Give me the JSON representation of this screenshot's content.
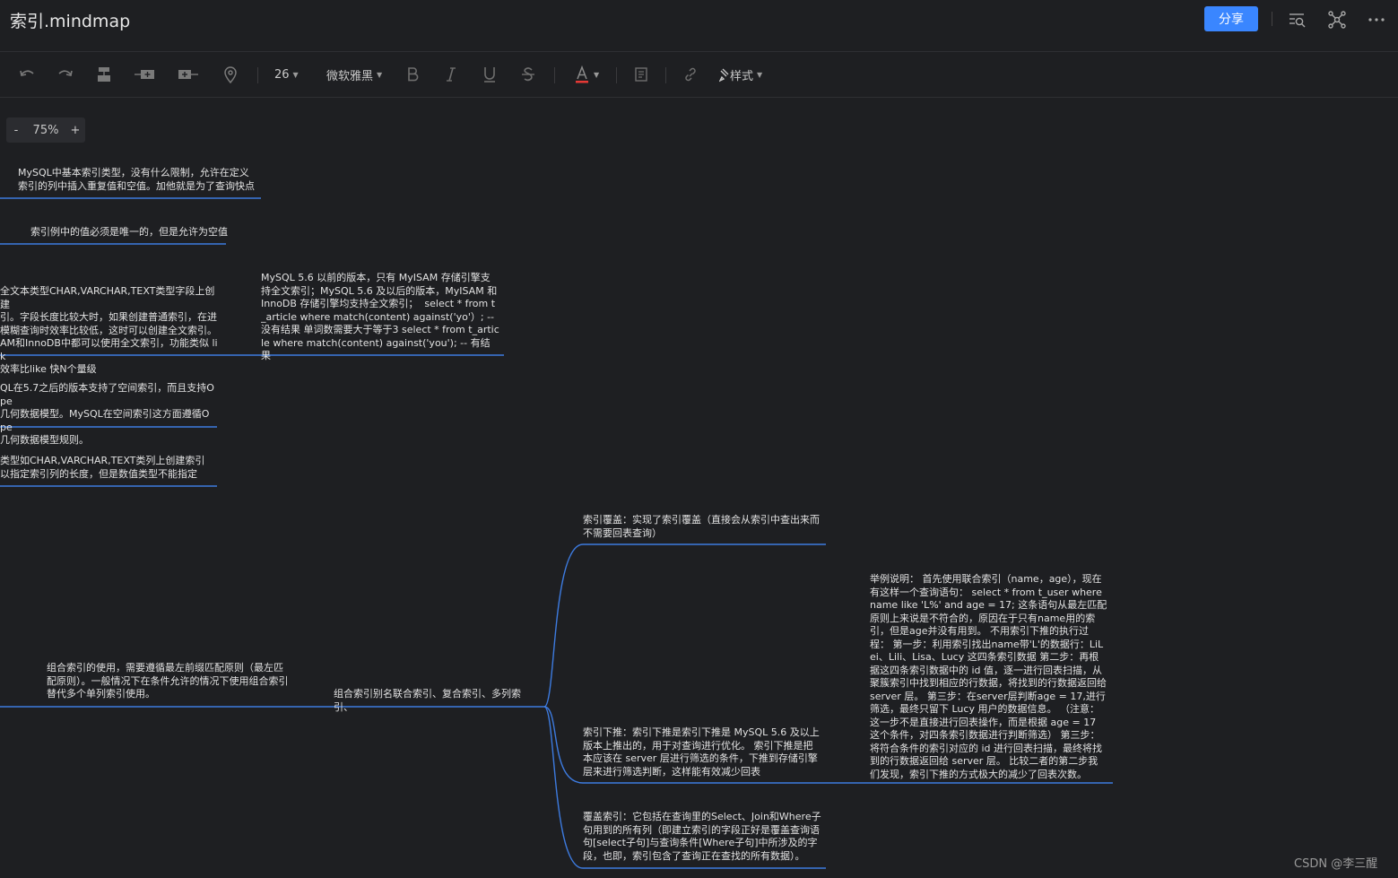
{
  "header": {
    "title": "索引.mindmap",
    "share_label": "分享",
    "icons": [
      "search-outline-icon",
      "mindmap-structure-icon",
      "more-icon"
    ]
  },
  "toolbar": {
    "font_size": "26",
    "font_family": "微软雅黑",
    "style_label": "样式",
    "icons": [
      "undo-icon",
      "redo-icon",
      "insert-child-icon",
      "insert-sibling-icon",
      "insert-parent-icon",
      "location-icon",
      "bold-icon",
      "italic-icon",
      "underline-icon",
      "strikethrough-icon",
      "font-color-icon",
      "note-icon",
      "link-icon",
      "style-brush-icon"
    ],
    "font_color": "#e53935"
  },
  "zoom": {
    "minus": "-",
    "value": "75%",
    "plus": "+"
  },
  "nodes": {
    "normal_index": "MySQL中基本索引类型，没有什么限制，允许在定义索引的列中插入重复值和空值。加他就是为了查询快点",
    "unique_index": "索引例中的值必须是唯一的，但是允许为空值",
    "fulltext_left": "全文本类型CHAR,VARCHAR,TEXT类型字段上创建\n引。字段长度比较大时，如果创建普通索引，在进\n模糊查询时效率比较低，这时可以创建全文索引。\nAM和InnoDB中都可以使用全文索引，功能类似 lik\n效率比like 快N个量级",
    "fulltext_right": "MySQL 5.6 以前的版本，只有 MyISAM 存储引擎支持全文索引；MySQL 5.6 及以后的版本，MyISAM 和 InnoDB 存储引擎均支持全文索引；  select * from t_article where match(content) against('yo'）; -- 没有结果 单词数需要大于等于3 select * from t_article where match(content) against('you'); -- 有结果",
    "spatial_index": "QL在5.7之后的版本支持了空间索引，而且支持Ope\n几何数据模型。MySQL在空间索引这方面遵循Ope\n几何数据模型规则。",
    "prefix_index": "类型如CHAR,VARCHAR,TEXT类列上创建索引\n以指定索引列的长度，但是数值类型不能指定",
    "composite_usage": "组合索引的使用，需要遵循最左前缀匹配原则（最左匹配原则）。一般情况下在条件允许的情况下使用组合索引替代多个单列索引使用。",
    "composite_alias": "组合索引别名联合索引、复合索引、多列索引、",
    "covering_top": "索引覆盖：实现了索引覆盖（直接会从索引中查出来而不需要回表查询）",
    "icp": "索引下推：索引下推是索引下推是 MySQL 5.6 及以上版本上推出的，用于对查询进行优化。 索引下推是把本应该在 server 层进行筛选的条件，下推到存储引擎层来进行筛选判断，这样能有效减少回表",
    "icp_example": "举例说明： 首先使用联合索引（name，age），现在有这样一个查询语句： select * from t_user where name like 'L%' and age = 17; 这条语句从最左匹配原则上来说是不符合的，原因在于只有name用的索引，但是age并没有用到。 不用索引下推的执行过程： 第一步：利用索引找出name带'L'的数据行：LiLei、Lili、Lisa、Lucy 这四条索引数据 第二步：再根据这四条索引数据中的 id 值，逐一进行回表扫描，从聚簇索引中找到相应的行数据，将找到的行数据返回给 server 层。 第三步：在server层判断age = 17,进行筛选，最终只留下 Lucy 用户的数据信息。 （注意：这一步不是直接进行回表操作，而是根据 age = 17 这个条件，对四条索引数据进行判断筛选） 第三步：将符合条件的索引对应的 id 进行回表扫描，最终将找到的行数据返回给 server 层。 比较二者的第二步我们发现，索引下推的方式极大的减少了回表次数。",
    "covering_bottom": "覆盖索引：它包括在查询里的Select、Join和Where子句用到的所有列（即建立索引的字段正好是覆盖查询语句[select子句]与查询条件[Where子句]中所涉及的字段，也即，索引包含了查询正在查找的所有数据）。"
  },
  "colors": {
    "accent": "#3a86ff",
    "link": "#3d7be0",
    "background": "#1e1f22"
  },
  "watermark": "CSDN @李三醒"
}
